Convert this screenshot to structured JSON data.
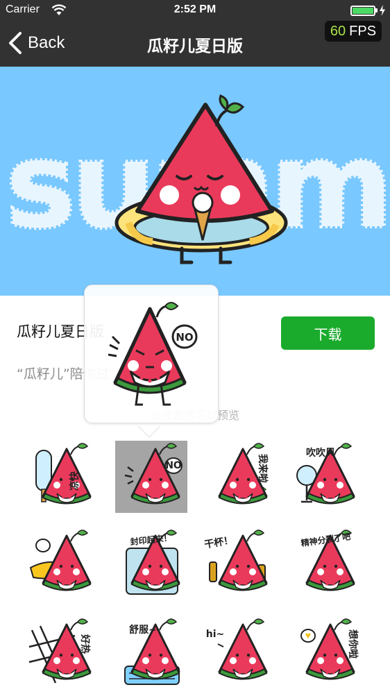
{
  "status_bar": {
    "carrier": "Carrier",
    "time": "2:52 PM",
    "battery_level": 1.0
  },
  "nav": {
    "back_label": "Back",
    "title": "瓜籽儿夏日版"
  },
  "fps": {
    "value": "60",
    "label": "FPS"
  },
  "banner": {
    "word": "summer"
  },
  "pack": {
    "name": "瓜籽儿夏日版",
    "description": "“瓜籽儿”陪你过",
    "download_label": "下载"
  },
  "hint": "长按表情可以预览",
  "popup": {
    "sticker_text": "NO"
  },
  "colors": {
    "nav_bg": "#323232",
    "banner_bg": "#79c8ff",
    "download_green": "#1aab2c",
    "watermelon_red": "#ea3a5b",
    "rind_green": "#3c9a3c",
    "selected_bg": "#a5a5a5",
    "fps_green": "#a8e04a"
  },
  "stickers": [
    {
      "name": "sticker-popsicle",
      "text": "凉快"
    },
    {
      "name": "sticker-no",
      "text": "NO"
    },
    {
      "name": "sticker-eat-watermelon",
      "text": "我来啦"
    },
    {
      "name": "sticker-fan",
      "text": "吹吹风"
    },
    {
      "name": "sticker-dizzy",
      "text": ""
    },
    {
      "name": "sticker-frozen",
      "text": "封印起来！"
    },
    {
      "name": "sticker-cheers",
      "text": "干杯！"
    },
    {
      "name": "sticker-split",
      "text": "精神分裂了吧"
    },
    {
      "name": "sticker-net",
      "text": "好热"
    },
    {
      "name": "sticker-aircon",
      "text": "舒服~"
    },
    {
      "name": "sticker-hi",
      "text": "hi~"
    },
    {
      "name": "sticker-heart",
      "text": "想你啦"
    }
  ]
}
